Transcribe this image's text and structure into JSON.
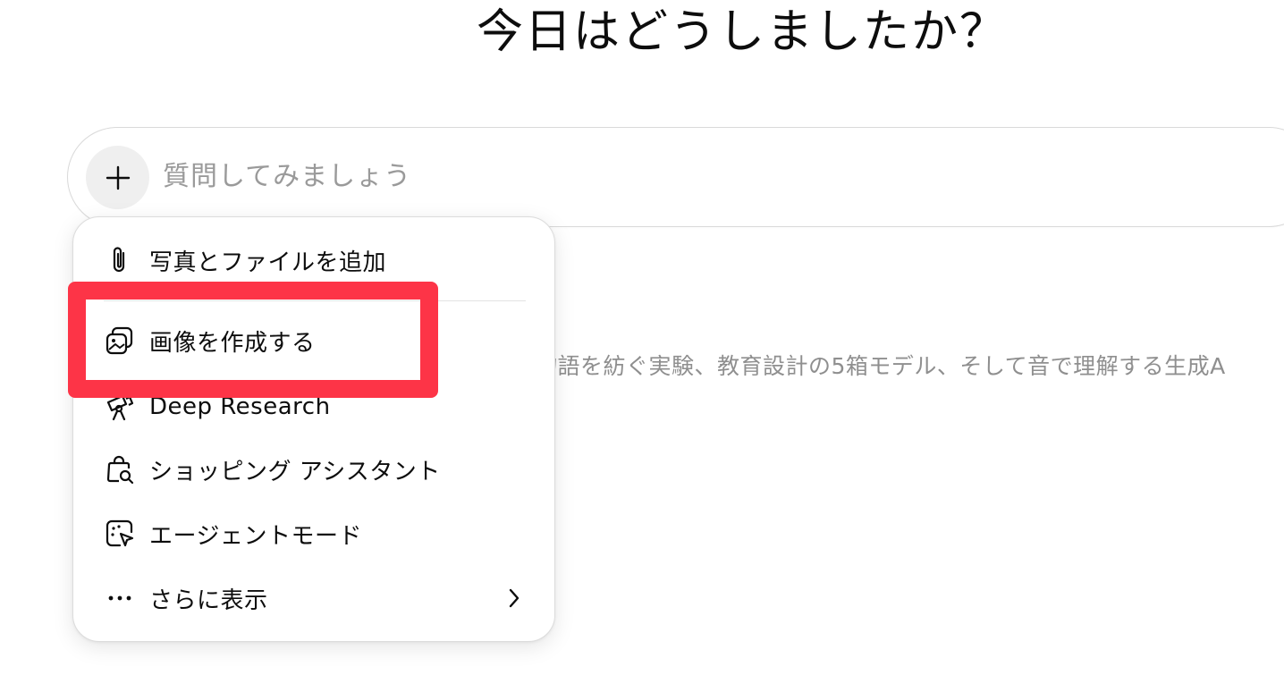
{
  "heading": "今日はどうしましたか？",
  "composer": {
    "placeholder": "質問してみましょう",
    "value": ""
  },
  "background_text": "物語を紡ぐ実験、教育設計の5箱モデル、そして音で理解する生成A",
  "menu": {
    "items": [
      {
        "label": "写真とファイルを追加",
        "icon": "paperclip-icon"
      },
      {
        "label": "画像を作成する",
        "icon": "image-create-icon"
      },
      {
        "label": "Deep Research",
        "icon": "telescope-icon"
      },
      {
        "label": "ショッピング アシスタント",
        "icon": "shopping-bag-search-icon"
      },
      {
        "label": "エージェントモード",
        "icon": "agent-cursor-icon"
      },
      {
        "label": "さらに表示",
        "icon": "more-dots-icon",
        "submenu_icon": "chevron-right-icon"
      }
    ]
  },
  "colors": {
    "highlight": "#fd3447",
    "placeholder": "#9a9a9a",
    "plus_button_bg": "#efefef"
  }
}
